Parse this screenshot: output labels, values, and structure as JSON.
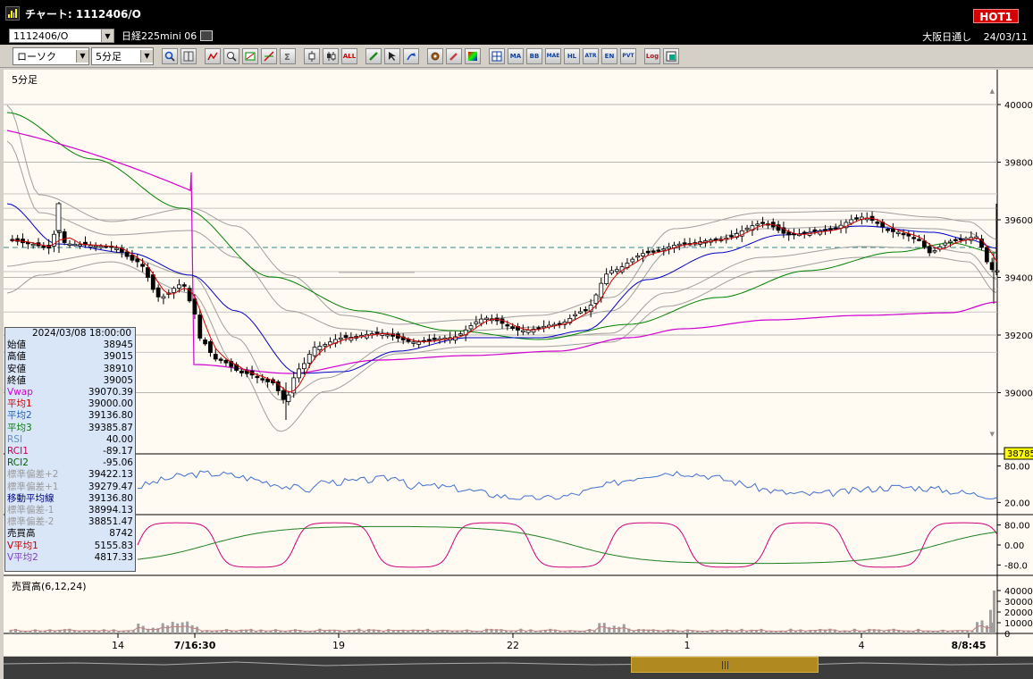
{
  "window": {
    "title": "チャート: 1112406/O",
    "hot_label": "HOT1"
  },
  "infobar": {
    "code": "1112406/O",
    "name": "日経225mini 06",
    "market": "大阪日通し",
    "date": "24/03/11"
  },
  "toolbar": {
    "chart_type": "ローソク",
    "period": "5分足",
    "buttons": [
      "search",
      "crosshair",
      "pan",
      "zoom",
      "box",
      "line",
      "trend",
      "pivot",
      "sigma",
      "bar",
      "candle",
      "all",
      "pen",
      "pointer",
      "arrow",
      "palette",
      "brush",
      "color",
      "MA",
      "BB",
      "MAE",
      "HL",
      "ATR",
      "EN",
      "PVT",
      "Log",
      "screen"
    ],
    "text_buttons": {
      "all": "ALL",
      "ma": "MA",
      "bb": "BB",
      "mae": "MAE",
      "hl": "HL",
      "atr": "ATR",
      "en": "EN",
      "pvt": "PVT",
      "log": "Log"
    }
  },
  "chart": {
    "period_label": "5分足",
    "volume_label": "売買高(6,12,24)",
    "price_ticks": [
      "40000",
      "39800",
      "39600",
      "39400",
      "39200",
      "39000"
    ],
    "rsi_ticks": [
      "80.00",
      "20.00"
    ],
    "rci_ticks": [
      "80.00",
      "0.00",
      "-80.0"
    ],
    "volume_ticks": [
      "40000",
      "30000",
      "20000",
      "10000",
      "0"
    ],
    "x_labels": [
      "14",
      "7/16:30",
      "19",
      "22",
      "1",
      "4",
      "8/8:45"
    ],
    "current_price_label": "38785",
    "colors": {
      "vwap": "#d000d0",
      "ma1": "#d00000",
      "ma2": "#0000c8",
      "ma3": "#008000",
      "bands": "#a0a0a0",
      "rsi": "#4070d0",
      "rci1": "#d0007a",
      "rci2": "#208020"
    }
  },
  "panel": {
    "datetime": "2024/03/08 18:00:00",
    "rows": [
      {
        "k": "始値",
        "v": "38945",
        "c": "#000"
      },
      {
        "k": "高値",
        "v": "39015",
        "c": "#000"
      },
      {
        "k": "安値",
        "v": "38910",
        "c": "#000"
      },
      {
        "k": "終値",
        "v": "39005",
        "c": "#000"
      },
      {
        "k": "Vwap",
        "v": "39070.39",
        "c": "#d000d0"
      },
      {
        "k": "平均1",
        "v": "39000.00",
        "c": "#d00000"
      },
      {
        "k": "平均2",
        "v": "39136.80",
        "c": "#2060c0"
      },
      {
        "k": "平均3",
        "v": "39385.87",
        "c": "#008000"
      },
      {
        "k": "RSI",
        "v": "40.00",
        "c": "#6090d0"
      },
      {
        "k": "RCI1",
        "v": "-89.17",
        "c": "#c00060"
      },
      {
        "k": "RCI2",
        "v": "-95.06",
        "c": "#006000"
      },
      {
        "k": "標準偏差+2",
        "v": "39422.13",
        "c": "#9a9a9a"
      },
      {
        "k": "標準偏差+1",
        "v": "39279.47",
        "c": "#9a9a9a"
      },
      {
        "k": "移動平均線",
        "v": "39136.80",
        "c": "#000080"
      },
      {
        "k": "標準偏差-1",
        "v": "38994.13",
        "c": "#9a9a9a"
      },
      {
        "k": "標準偏差-2",
        "v": "38851.47",
        "c": "#9a9a9a"
      },
      {
        "k": "売買高",
        "v": "8742",
        "c": "#000"
      },
      {
        "k": "V平均1",
        "v": "5155.83",
        "c": "#c00000"
      },
      {
        "k": "V平均2",
        "v": "4817.33",
        "c": "#8040c0"
      }
    ]
  }
}
